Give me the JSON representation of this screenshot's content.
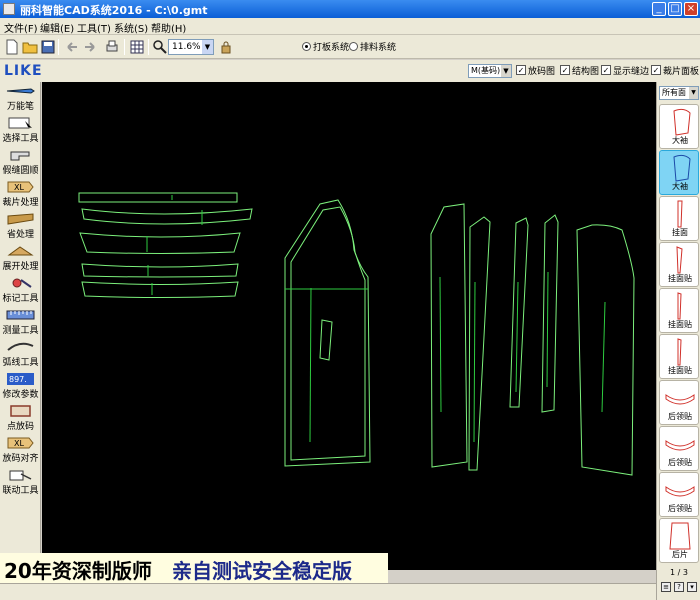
{
  "window": {
    "title": "丽科智能CAD系统2016 - C:\\0.gmt",
    "minimize": "_",
    "maximize": "□",
    "close": "×"
  },
  "menu": [
    "文件(F)",
    "编辑(E)",
    "工具(T)",
    "系统(S)",
    "帮助(H)"
  ],
  "toolbar": {
    "zoom_value": "11.6%",
    "mode_options": [
      "打板系统",
      "排料系统"
    ],
    "mode_selected": "打板系统"
  },
  "brand": {
    "logo_text": "LIKE"
  },
  "options_bar": {
    "size_select": "M(基码)",
    "checkboxes": [
      {
        "label": "放码图",
        "checked": true
      },
      {
        "label": "结构图",
        "checked": true
      },
      {
        "label": "显示缝边",
        "checked": true
      },
      {
        "label": "裁片面板",
        "checked": true
      }
    ]
  },
  "left_tools": [
    {
      "label": "万能笔",
      "icon": "pen-icon"
    },
    {
      "label": "选择工具",
      "icon": "select-icon"
    },
    {
      "label": "假缝圆顺",
      "icon": "sewing-machine-icon"
    },
    {
      "label": "裁片处理",
      "icon": "pattern-piece-icon",
      "badge": "XL"
    },
    {
      "label": "省处理",
      "icon": "dart-icon"
    },
    {
      "label": "展开处理",
      "icon": "expand-icon"
    },
    {
      "label": "标记工具",
      "icon": "mark-icon"
    },
    {
      "label": "测量工具",
      "icon": "ruler-icon"
    },
    {
      "label": "弧线工具",
      "icon": "curve-icon"
    },
    {
      "label": "修改参数",
      "icon": "parameter-icon",
      "badge": "897."
    },
    {
      "label": "点放码",
      "icon": "point-grading-icon"
    },
    {
      "label": "放码对齐",
      "icon": "grading-align-icon",
      "badge": "XL"
    },
    {
      "label": "联动工具",
      "icon": "link-icon"
    }
  ],
  "right_panel": {
    "filter": "所有面",
    "pieces": [
      {
        "label": "大袖",
        "active": false
      },
      {
        "label": "大袖",
        "active": true
      },
      {
        "label": "挂面",
        "active": false
      },
      {
        "label": "挂面贴",
        "active": false
      },
      {
        "label": "挂面贴",
        "active": false
      },
      {
        "label": "挂面贴",
        "active": false
      },
      {
        "label": "后领贴",
        "active": false
      },
      {
        "label": "后领贴",
        "active": false
      },
      {
        "label": "后领贴",
        "active": false
      },
      {
        "label": "后片",
        "active": false
      }
    ],
    "pager": "1 / 3"
  },
  "banner": {
    "part1": "20年资深制版师",
    "part2": "亲自测试安全稳定版"
  },
  "colors": {
    "canvas_bg": "#000000",
    "piece_outline": "#7cf07c",
    "grain_line": "#2ecc40",
    "piece_thumb_stroke": "#d0302a",
    "active_thumb_bg": "#7fd4f4"
  }
}
